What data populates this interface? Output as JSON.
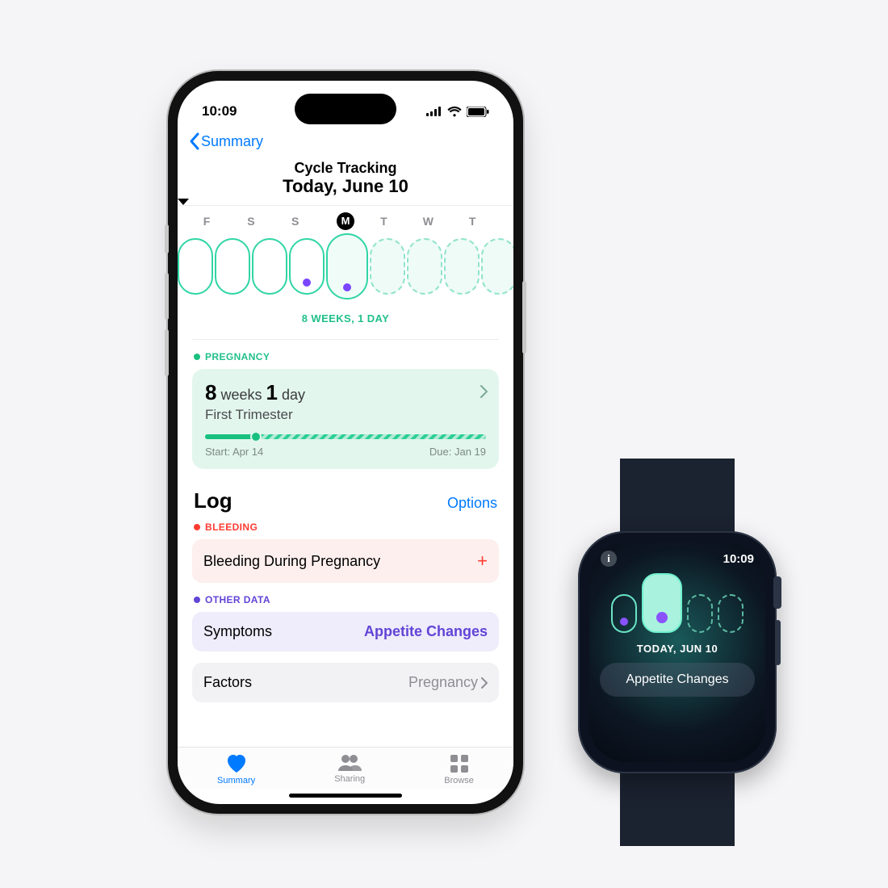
{
  "phone": {
    "status": {
      "time": "10:09"
    },
    "nav": {
      "back": "Summary",
      "title": "Cycle Tracking"
    },
    "today_title": "Today, June 10",
    "days": [
      "F",
      "S",
      "S",
      "M",
      "T",
      "W",
      "T"
    ],
    "weeks_caption": "8 WEEKS, 1 DAY",
    "pregnancy": {
      "label": "PREGNANCY",
      "weeks_n": "8",
      "weeks_u": "weeks",
      "days_n": "1",
      "days_u": "day",
      "trimester": "First Trimester",
      "start_label": "Start: Apr 14",
      "due_label": "Due: Jan 19"
    },
    "log": {
      "title": "Log",
      "options": "Options",
      "bleeding_label": "BLEEDING",
      "bleeding_row": "Bleeding During Pregnancy",
      "other_label": "OTHER DATA",
      "symptoms_row": "Symptoms",
      "symptoms_value": "Appetite Changes",
      "factors_row": "Factors",
      "factors_value": "Pregnancy"
    },
    "tabs": {
      "summary": "Summary",
      "sharing": "Sharing",
      "browse": "Browse"
    },
    "colors": {
      "blue": "#007aff",
      "green": "#17c07f",
      "teal": "#2fd5a5",
      "red": "#ff3b30",
      "purple": "#6244d6"
    }
  },
  "watch": {
    "time": "10:09",
    "today": "TODAY, JUN 10",
    "pill": "Appetite Changes"
  }
}
